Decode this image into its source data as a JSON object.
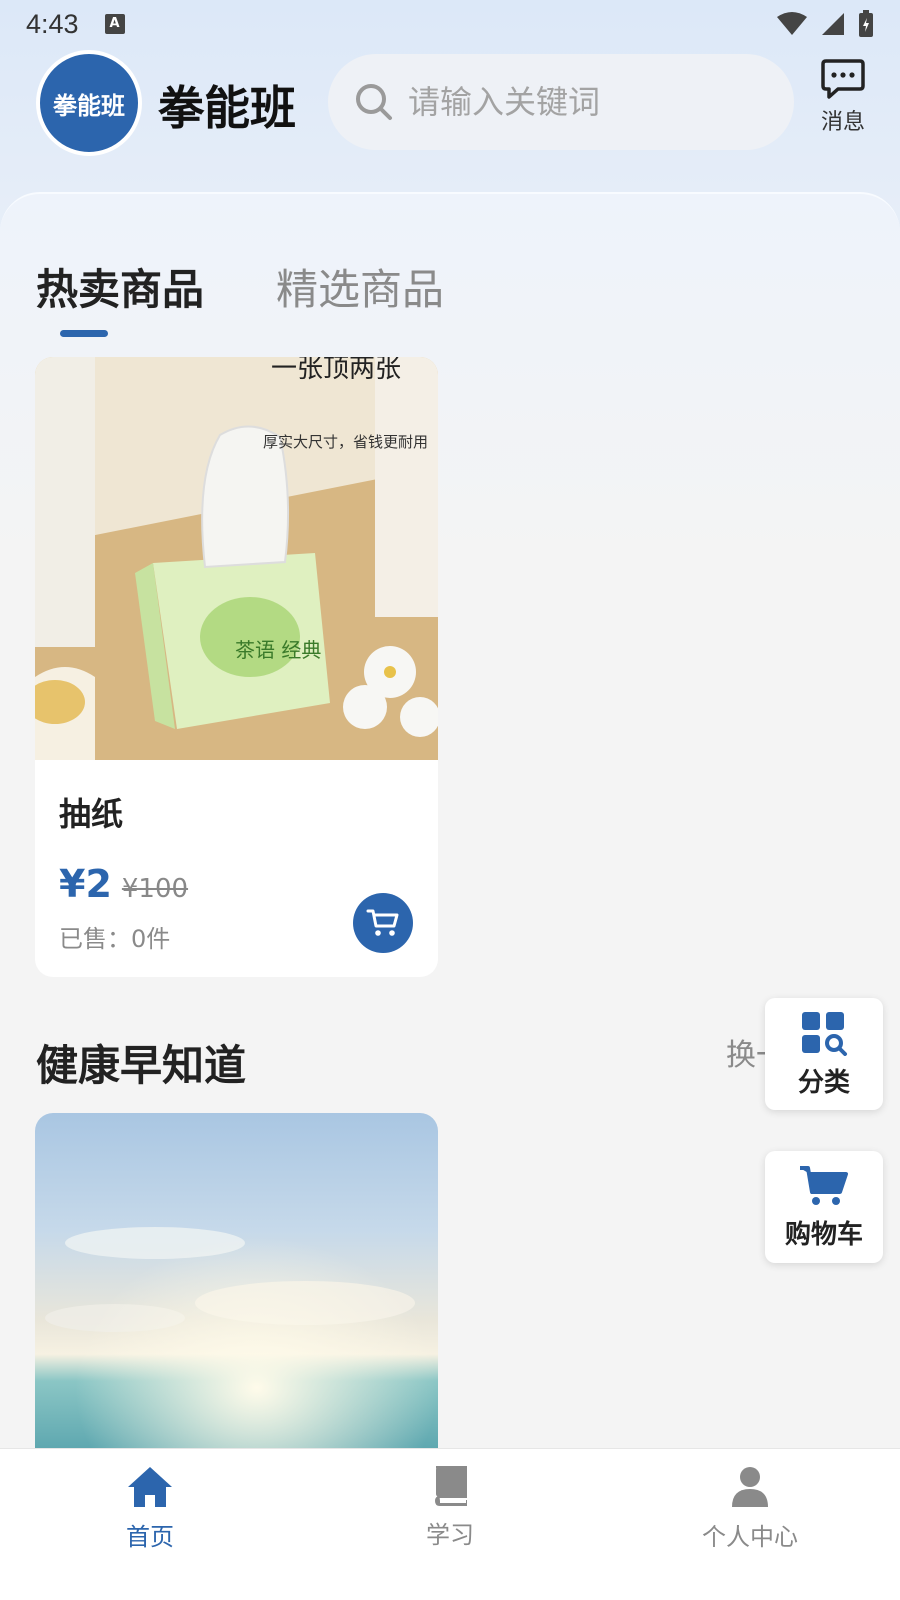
{
  "status_bar": {
    "time": "4:43",
    "notif_icon": "A"
  },
  "header": {
    "logo_text": "拳能班",
    "app_name": "拳能班",
    "search_placeholder": "请输入关键词",
    "message_label": "消息"
  },
  "tabs": [
    {
      "label": "热卖商品",
      "active": true
    },
    {
      "label": "精选商品",
      "active": false
    }
  ],
  "product": {
    "title": "抽纸",
    "price": "¥2",
    "original_price": "¥100",
    "sold": "已售：0件",
    "image_text_top": "一张顶两张",
    "image_text_sub": "厚实大尺寸，省钱更耐用",
    "image_text_box": "茶语 经典"
  },
  "health_section": {
    "title": "健康早知道",
    "more": "换一换"
  },
  "floating": {
    "category_label": "分类",
    "cart_label": "购物车"
  },
  "bottom_nav": [
    {
      "label": "首页",
      "active": true
    },
    {
      "label": "学习",
      "active": false
    },
    {
      "label": "个人中心",
      "active": false
    }
  ],
  "colors": {
    "accent": "#2c65ad",
    "muted": "#8a8a8a"
  }
}
